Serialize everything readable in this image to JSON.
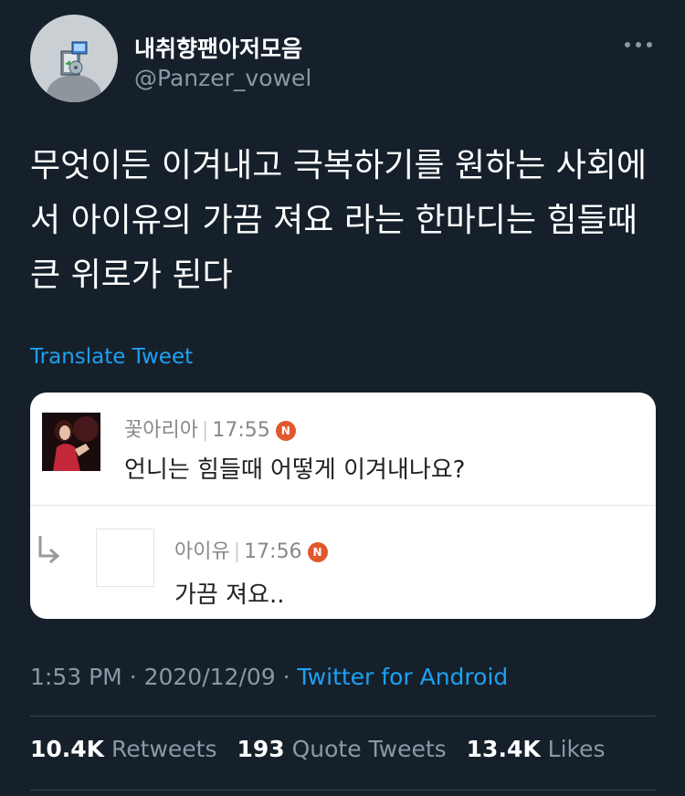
{
  "author": {
    "display_name": "내취향팬아저모음",
    "handle": "@Panzer_vowel",
    "avatar_icon": "installer-icon"
  },
  "tweet": {
    "text": "무엇이든 이겨내고 극복하기를 원하는 사회에서 아이유의 가끔 져요 라는 한마디는 힘들때 큰 위로가 된다",
    "translate_label": "Translate Tweet"
  },
  "card": {
    "comment": {
      "name": "꽃아리아",
      "time": "17:55",
      "badge": "N",
      "message": "언니는 힘들때 어떻게 이겨내나요?"
    },
    "reply": {
      "name": "아이유",
      "time": "17:56",
      "badge": "N",
      "message": "가끔 져요.."
    }
  },
  "meta": {
    "time": "1:53 PM",
    "sep": "·",
    "date": "2020/12/09",
    "source": "Twitter for Android"
  },
  "stats": {
    "retweets_count": "10.4K",
    "retweets_label": "Retweets",
    "quotes_count": "193",
    "quotes_label": "Quote Tweets",
    "likes_count": "13.4K",
    "likes_label": "Likes"
  },
  "colors": {
    "background": "#15202b",
    "accent": "#1da1f2",
    "muted": "#8b98a5",
    "badge": "#e2572d"
  }
}
